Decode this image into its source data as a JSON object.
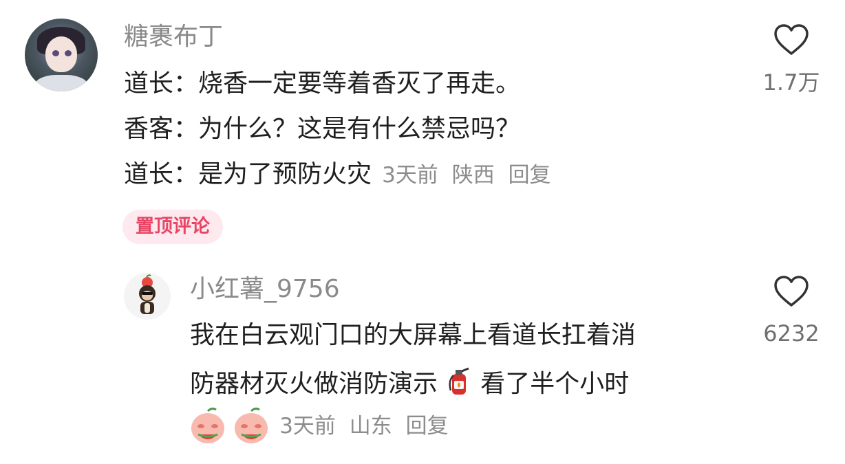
{
  "comment": {
    "username": "糖裹布丁",
    "lines": [
      "道长：烧香一定要等着香灭了再走。",
      "香客：为什么？这是有什么禁忌吗？",
      "道长：是为了预防火灾"
    ],
    "time": "3天前",
    "location": "陕西",
    "reply_label": "回复",
    "like_count": "1.7万",
    "pinned_label": "置顶评论"
  },
  "reply": {
    "username": "小红薯_9756",
    "line1": "我在白云观门口的大屏幕上看道长扛着消",
    "line2_before_emoji": "防器材灭火做消防演示",
    "line2_after_emoji": "看了半个小时",
    "time": "3天前",
    "location": "山东",
    "reply_label": "回复",
    "like_count": "6232"
  },
  "icons": {
    "like": "heart-outline-icon",
    "extinguisher": "fire-extinguisher-emoji",
    "sticker": "peach-eating-watermelon-sticker"
  },
  "colors": {
    "pinned_text": "#e84566",
    "pinned_bg": "#fde9ee",
    "username": "#8a8a8a",
    "meta": "#8c8c8c"
  }
}
